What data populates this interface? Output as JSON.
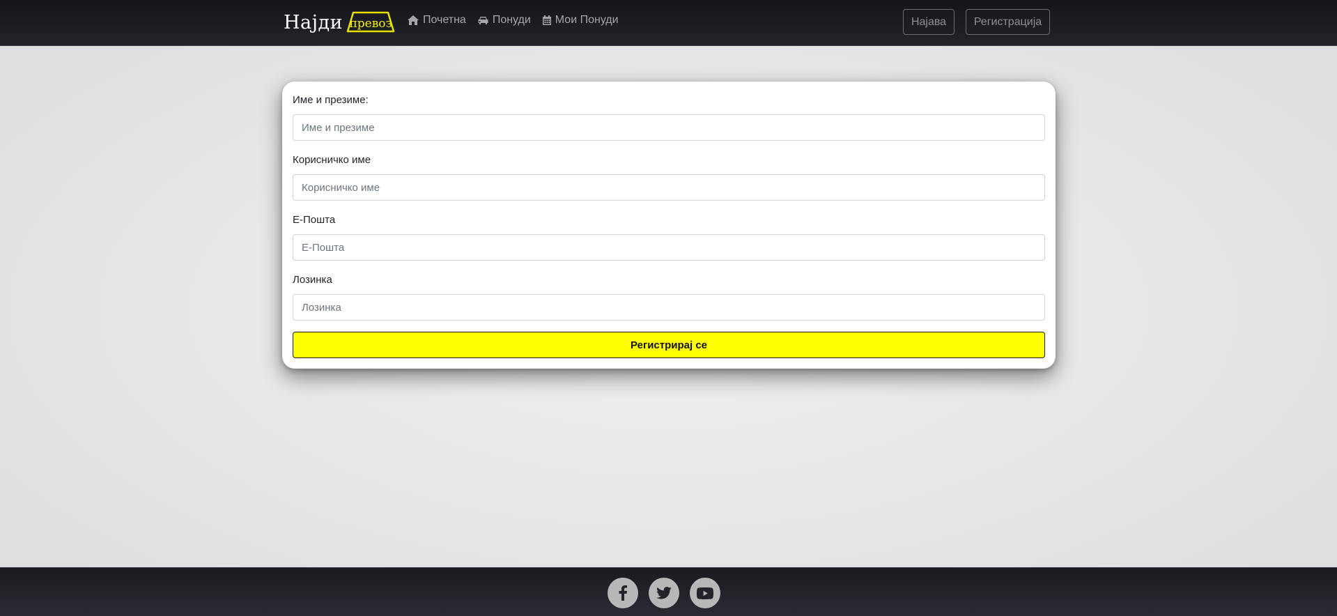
{
  "brand": {
    "name": "Најди",
    "badge": "превоз",
    "badge_color": "#f5f000"
  },
  "nav": {
    "links": [
      {
        "label": "Почетна",
        "icon": "home-icon"
      },
      {
        "label": "Понуди",
        "icon": "car-icon"
      },
      {
        "label": "Мои Понуди",
        "icon": "calendar-icon"
      }
    ],
    "login_label": "Најава",
    "register_label": "Регистрација"
  },
  "form": {
    "fields": [
      {
        "label": "Име и презиме:",
        "placeholder": "Име и презиме",
        "value": ""
      },
      {
        "label": "Корисничко име",
        "placeholder": "Корисничко име",
        "value": ""
      },
      {
        "label": "Е-Пошта",
        "placeholder": "Е-Пошта",
        "value": ""
      },
      {
        "label": "Лозинка",
        "placeholder": "Лозинка",
        "value": ""
      }
    ],
    "submit_label": "Регистрирај се",
    "submit_color": "#ffff00"
  },
  "footer": {
    "social": [
      {
        "icon": "facebook-icon"
      },
      {
        "icon": "twitter-icon"
      },
      {
        "icon": "youtube-icon"
      }
    ]
  }
}
